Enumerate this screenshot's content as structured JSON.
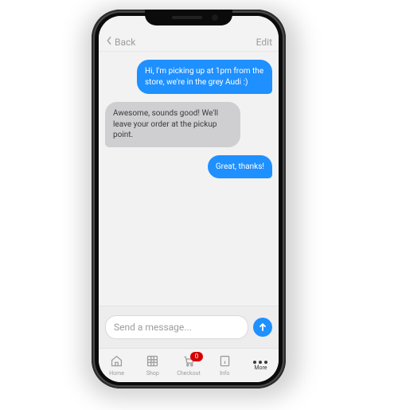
{
  "nav": {
    "back": "Back",
    "edit": "Edit"
  },
  "messages": [
    {
      "text": "Hi, I'm picking up at 1pm from the store, we're in the grey Audi :)",
      "side": "sent"
    },
    {
      "text": "Awesome, sounds good! We'll leave your order at the pickup point.",
      "side": "recv"
    },
    {
      "text": "Great, thanks!",
      "side": "sent"
    }
  ],
  "composer": {
    "placeholder": "Send a message..."
  },
  "tabs": {
    "home": "Home",
    "shop": "Shop",
    "checkout": "Checkout",
    "info": "Info",
    "more": "More",
    "badge": "0"
  }
}
